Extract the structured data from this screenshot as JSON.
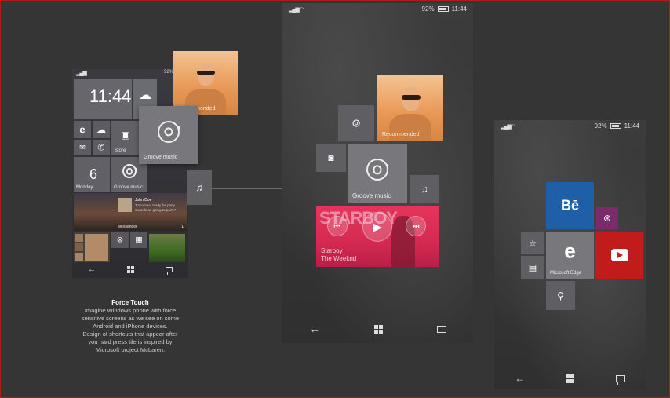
{
  "phone_left": {
    "status": {
      "battery": "92%"
    },
    "clock": "11:44",
    "tiles": {
      "store_label": "Store",
      "day_number": "6",
      "day_label": "Monday",
      "groove_small_label": "Groove music",
      "messenger_label": "Messenger",
      "messenger_name": "John Doe",
      "messenger_text": "Tomorrow, ready for party. Sounds as going to party?",
      "messenger_count": "1"
    }
  },
  "overlay_left": {
    "recommended_label": "Recommended",
    "groove_label": "Groove music"
  },
  "caption": {
    "title": "Force Touch",
    "lines": [
      "Imagine Windows phone with force",
      "sensitive screens as we see on some",
      "Android and iPhone devices.",
      "Design of shortcuts that appear after",
      "you hard press tile is inspired by",
      "Microsoft project McLaren."
    ]
  },
  "phone_middle": {
    "status": {
      "battery": "92%",
      "time": "11:44"
    },
    "recommended_label": "Recommended",
    "groove_label": "Groove music",
    "starboy": {
      "banner": "STARBOY",
      "track": "Starboy",
      "artist": "The Weeknd"
    }
  },
  "phone_right": {
    "status": {
      "battery": "92%",
      "time": "11:44"
    },
    "behance_label": "Bē",
    "edge_label": "Microsoft Edge"
  },
  "colors": {
    "background": "#353535",
    "tile_gray": "#5a5a5e",
    "behance_blue": "#1f5fa8",
    "youtube_red": "#c11b1b",
    "dribbble_purple": "#7b2a6a",
    "starboy_pink": "#d42a52",
    "border_red": "#b11a1a"
  }
}
